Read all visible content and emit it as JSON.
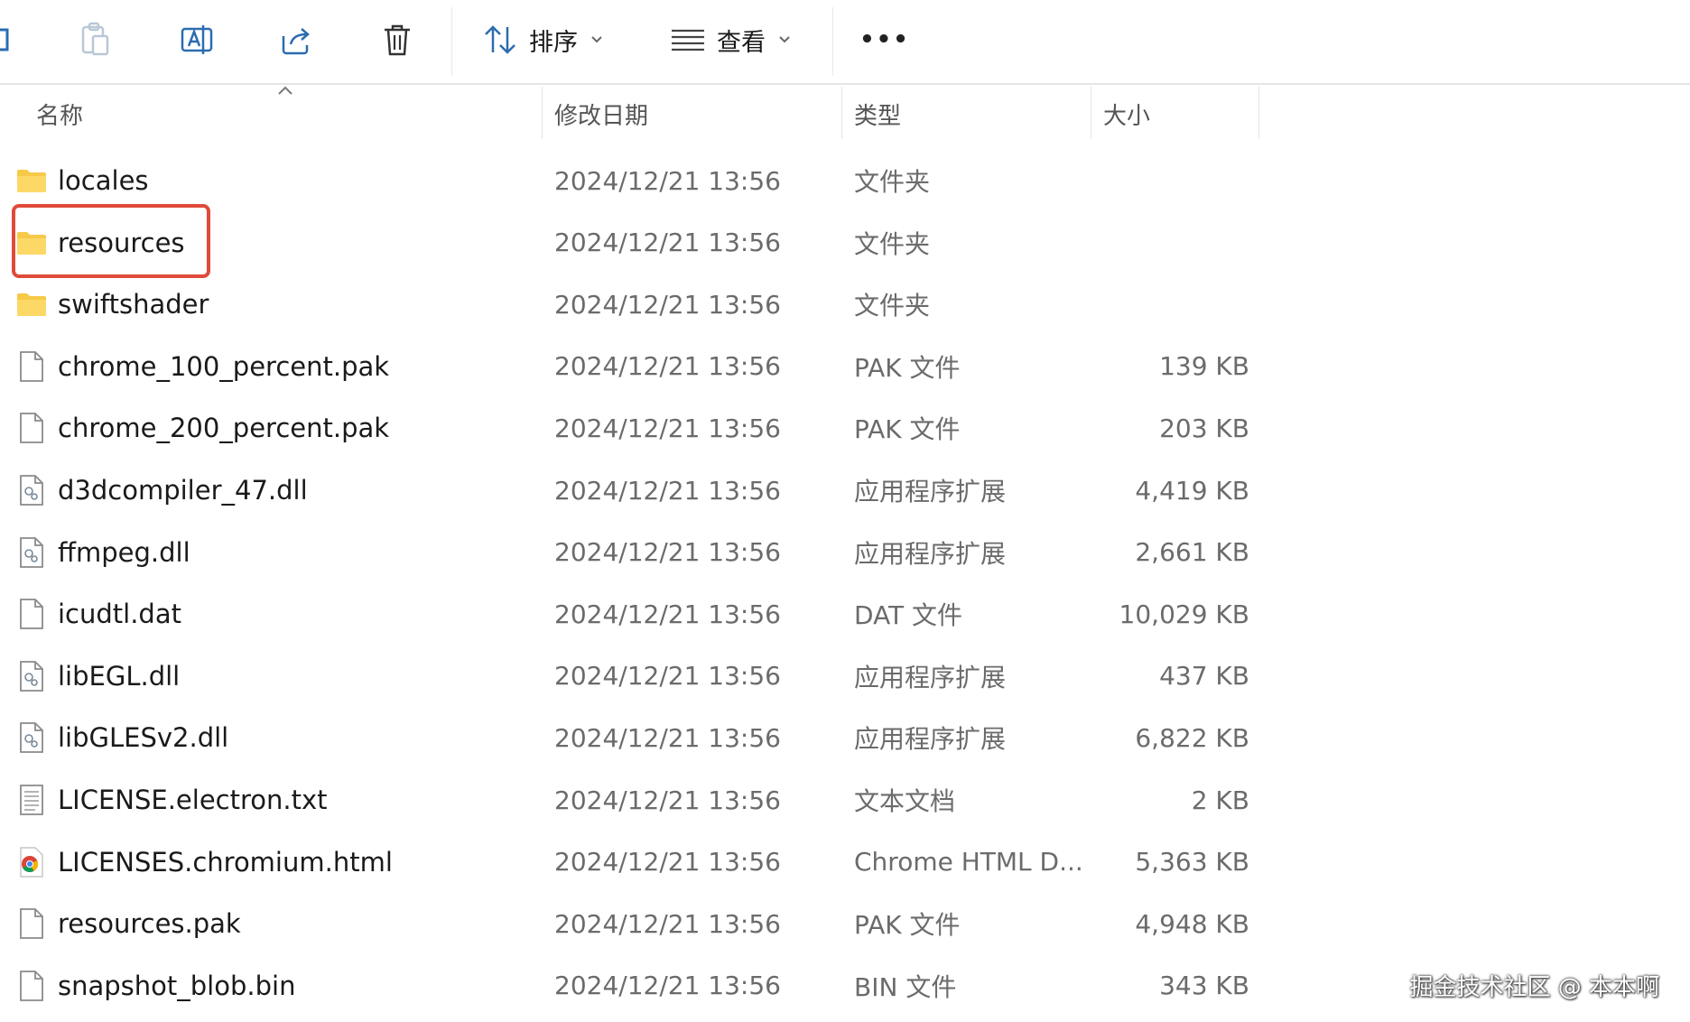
{
  "toolbar": {
    "sort_label": "排序",
    "view_label": "查看",
    "more_label": "•••"
  },
  "columns": {
    "name": "名称",
    "modified": "修改日期",
    "type": "类型",
    "size": "大小"
  },
  "files": [
    {
      "name": "locales",
      "modified": "2024/12/21 13:56",
      "type": "文件夹",
      "size": "",
      "icon": "folder-icon"
    },
    {
      "name": "resources",
      "modified": "2024/12/21 13:56",
      "type": "文件夹",
      "size": "",
      "icon": "folder-icon"
    },
    {
      "name": "swiftshader",
      "modified": "2024/12/21 13:56",
      "type": "文件夹",
      "size": "",
      "icon": "folder-icon"
    },
    {
      "name": "chrome_100_percent.pak",
      "modified": "2024/12/21 13:56",
      "type": "PAK 文件",
      "size": "139 KB",
      "icon": "file-icon"
    },
    {
      "name": "chrome_200_percent.pak",
      "modified": "2024/12/21 13:56",
      "type": "PAK 文件",
      "size": "203 KB",
      "icon": "file-icon"
    },
    {
      "name": "d3dcompiler_47.dll",
      "modified": "2024/12/21 13:56",
      "type": "应用程序扩展",
      "size": "4,419 KB",
      "icon": "dll-icon"
    },
    {
      "name": "ffmpeg.dll",
      "modified": "2024/12/21 13:56",
      "type": "应用程序扩展",
      "size": "2,661 KB",
      "icon": "dll-icon"
    },
    {
      "name": "icudtl.dat",
      "modified": "2024/12/21 13:56",
      "type": "DAT 文件",
      "size": "10,029 KB",
      "icon": "file-icon"
    },
    {
      "name": "libEGL.dll",
      "modified": "2024/12/21 13:56",
      "type": "应用程序扩展",
      "size": "437 KB",
      "icon": "dll-icon"
    },
    {
      "name": "libGLESv2.dll",
      "modified": "2024/12/21 13:56",
      "type": "应用程序扩展",
      "size": "6,822 KB",
      "icon": "dll-icon"
    },
    {
      "name": "LICENSE.electron.txt",
      "modified": "2024/12/21 13:56",
      "type": "文本文档",
      "size": "2 KB",
      "icon": "text-file-icon"
    },
    {
      "name": "LICENSES.chromium.html",
      "modified": "2024/12/21 13:56",
      "type": "Chrome HTML D...",
      "size": "5,363 KB",
      "icon": "chrome-html-icon"
    },
    {
      "name": "resources.pak",
      "modified": "2024/12/21 13:56",
      "type": "PAK 文件",
      "size": "4,948 KB",
      "icon": "file-icon"
    },
    {
      "name": "snapshot_blob.bin",
      "modified": "2024/12/21 13:56",
      "type": "BIN 文件",
      "size": "343 KB",
      "icon": "file-icon"
    }
  ],
  "watermark": "掘金技术社区 @ 本本啊",
  "colors": {
    "highlight": "#e04a3a",
    "folder": "#f7c948",
    "accent": "#2b6cb0"
  }
}
